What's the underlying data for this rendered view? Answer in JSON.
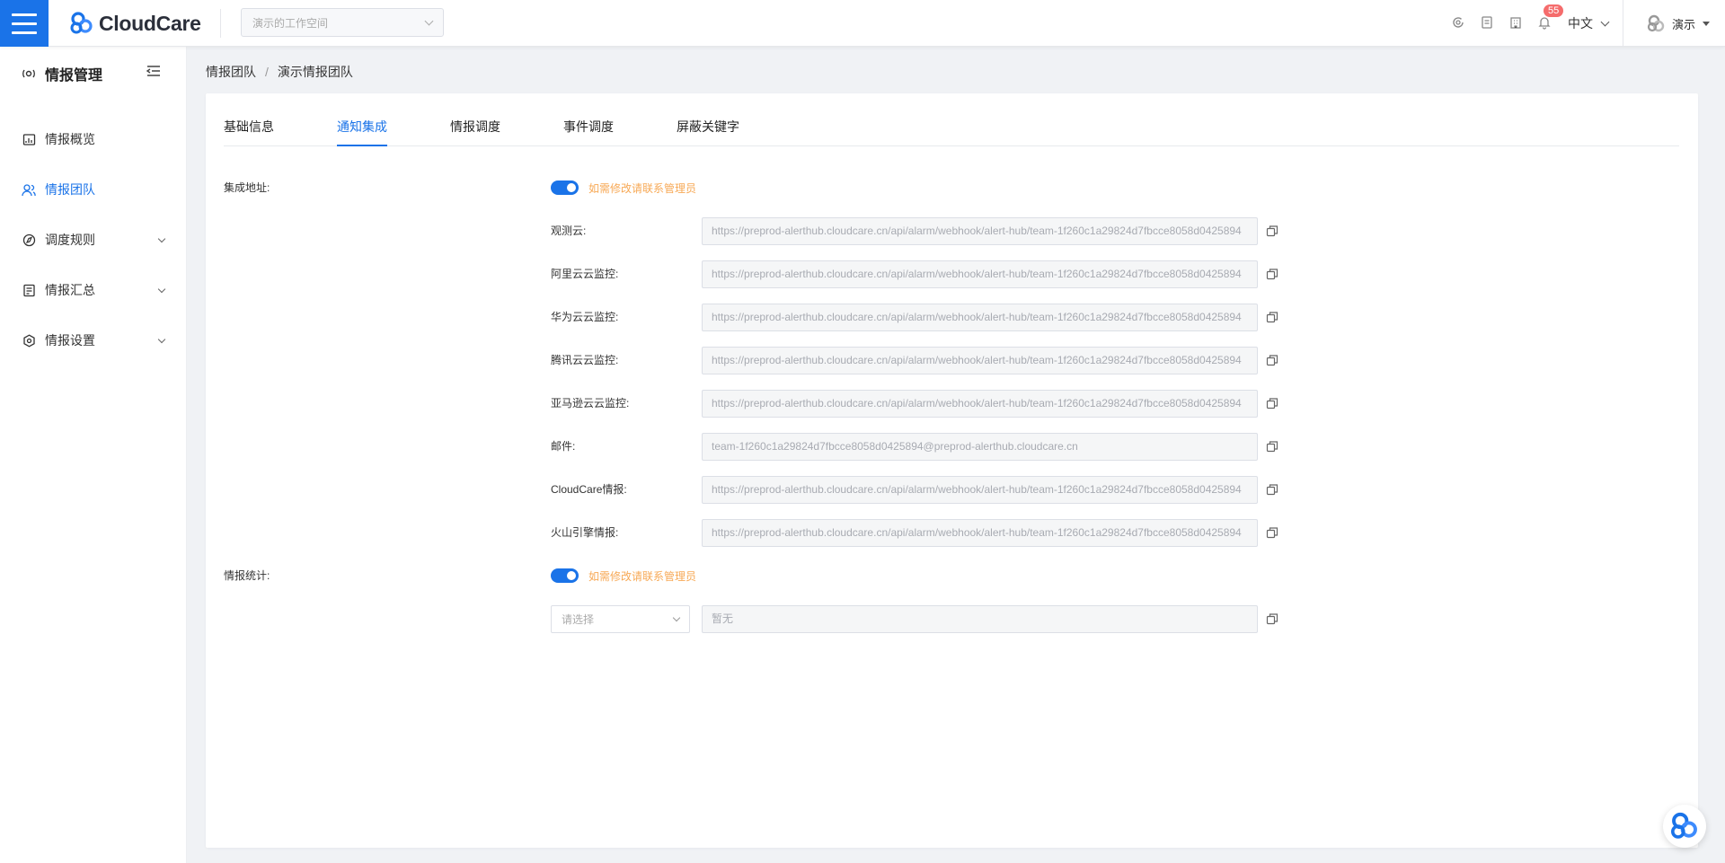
{
  "header": {
    "brand": "CloudCare",
    "workspace_placeholder": "演示的工作空间",
    "notification_count": "55",
    "language": "中文",
    "user_name": "演示"
  },
  "sidebar": {
    "title": "情报管理",
    "items": [
      {
        "label": "情报概览",
        "icon": "overview-icon"
      },
      {
        "label": "情报团队",
        "icon": "team-icon",
        "active": true
      },
      {
        "label": "调度规则",
        "icon": "schedule-icon",
        "expandable": true
      },
      {
        "label": "情报汇总",
        "icon": "summary-icon",
        "expandable": true
      },
      {
        "label": "情报设置",
        "icon": "settings-icon",
        "expandable": true
      }
    ]
  },
  "breadcrumb": {
    "items": [
      "情报团队",
      "演示情报团队"
    ],
    "separator": "/"
  },
  "tabs": [
    {
      "label": "基础信息"
    },
    {
      "label": "通知集成",
      "active": true
    },
    {
      "label": "情报调度"
    },
    {
      "label": "事件调度"
    },
    {
      "label": "屏蔽关键字"
    }
  ],
  "integration": {
    "label": "集成地址:",
    "toggle_on": true,
    "hint": "如需修改请联系管理员",
    "rows": [
      {
        "label": "观测云:",
        "value": "https://preprod-alerthub.cloudcare.cn/api/alarm/webhook/alert-hub/team-1f260c1a29824d7fbcce8058d0425894"
      },
      {
        "label": "阿里云云监控:",
        "value": "https://preprod-alerthub.cloudcare.cn/api/alarm/webhook/alert-hub/team-1f260c1a29824d7fbcce8058d0425894"
      },
      {
        "label": "华为云云监控:",
        "value": "https://preprod-alerthub.cloudcare.cn/api/alarm/webhook/alert-hub/team-1f260c1a29824d7fbcce8058d0425894"
      },
      {
        "label": "腾讯云云监控:",
        "value": "https://preprod-alerthub.cloudcare.cn/api/alarm/webhook/alert-hub/team-1f260c1a29824d7fbcce8058d0425894"
      },
      {
        "label": "亚马逊云云监控:",
        "value": "https://preprod-alerthub.cloudcare.cn/api/alarm/webhook/alert-hub/team-1f260c1a29824d7fbcce8058d0425894"
      },
      {
        "label": "邮件:",
        "value": "team-1f260c1a29824d7fbcce8058d0425894@preprod-alerthub.cloudcare.cn"
      },
      {
        "label": "CloudCare情报:",
        "value": "https://preprod-alerthub.cloudcare.cn/api/alarm/webhook/alert-hub/team-1f260c1a29824d7fbcce8058d0425894"
      },
      {
        "label": "火山引擎情报:",
        "value": "https://preprod-alerthub.cloudcare.cn/api/alarm/webhook/alert-hub/team-1f260c1a29824d7fbcce8058d0425894"
      }
    ]
  },
  "statistics": {
    "label": "情报统计:",
    "toggle_on": true,
    "hint": "如需修改请联系管理员",
    "select_placeholder": "请选择",
    "value": "暂无"
  },
  "colors": {
    "primary": "#1a73e8",
    "hint": "#f7a956",
    "badge": "#f56c6c"
  }
}
